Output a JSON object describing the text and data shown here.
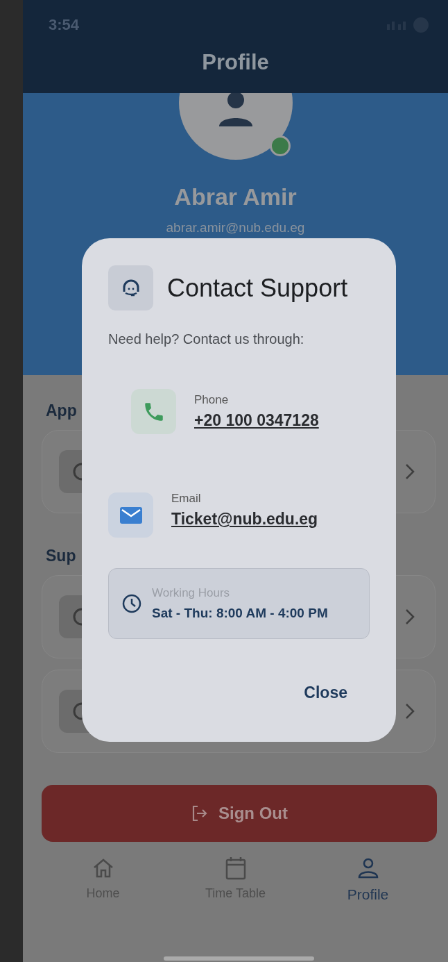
{
  "status_bar": {
    "time": "3:54"
  },
  "header": {
    "title": "Profile"
  },
  "profile": {
    "name": "Abrar Amir",
    "email": "abrar.amir@nub.edu.eg",
    "online": true
  },
  "sections": [
    {
      "title": "App",
      "items": [
        {
          "kind": "link"
        }
      ]
    },
    {
      "title": "Sup",
      "items": [
        {
          "kind": "link"
        },
        {
          "kind": "link"
        }
      ]
    }
  ],
  "sign_out": {
    "label": "Sign Out"
  },
  "nav": [
    {
      "label": "Home",
      "kind": "home",
      "selected": false
    },
    {
      "label": "Time Table",
      "kind": "calendar",
      "selected": false
    },
    {
      "label": "Profile",
      "kind": "person",
      "selected": true
    }
  ],
  "dialog": {
    "title": "Contact Support",
    "subtitle": "Need help? Contact us through:",
    "contacts": [
      {
        "kind": "phone",
        "label": "Phone",
        "value": "+20 100 0347128"
      },
      {
        "kind": "email",
        "label": "Email",
        "value": "Ticket@nub.edu.eg"
      }
    ],
    "hours": {
      "label": "Working Hours",
      "value": "Sat - Thu: 8:00 AM - 4:00 PM"
    },
    "close": "Close"
  }
}
